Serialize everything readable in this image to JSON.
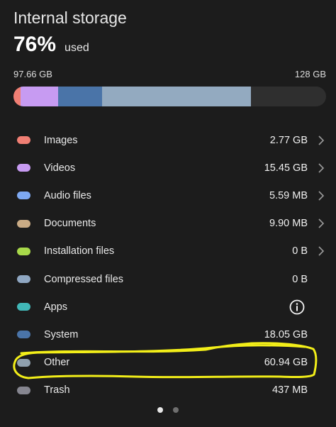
{
  "header": {
    "title": "Internal storage",
    "percent": "76%",
    "used_label": "used"
  },
  "bar": {
    "used_label": "97.66 GB",
    "total_label": "128 GB",
    "segments": [
      {
        "category": "Images",
        "gb": 2.77,
        "color": "#f07f74"
      },
      {
        "category": "Videos",
        "gb": 15.45,
        "color": "#c79bf2"
      },
      {
        "category": "System",
        "gb": 18.05,
        "color": "#4a74a8"
      },
      {
        "category": "Other",
        "gb": 60.94,
        "color": "#93aac0"
      }
    ],
    "total_gb": 128,
    "empty_color": "#2f2f2f"
  },
  "items": [
    {
      "label": "Images",
      "value": "2.77 GB",
      "color": "#f07f74",
      "action": "chevron"
    },
    {
      "label": "Videos",
      "value": "15.45 GB",
      "color": "#c79bf2",
      "action": "chevron"
    },
    {
      "label": "Audio files",
      "value": "5.59 MB",
      "color": "#7ea9f2",
      "action": "chevron"
    },
    {
      "label": "Documents",
      "value": "9.90 MB",
      "color": "#c9ab85",
      "action": "chevron"
    },
    {
      "label": "Installation files",
      "value": "0 B",
      "color": "#a8d94a",
      "action": "chevron"
    },
    {
      "label": "Compressed files",
      "value": "0 B",
      "color": "#8fa7c2",
      "action": "none"
    },
    {
      "label": "Apps",
      "value": "",
      "color": "#41b7b7",
      "action": "info"
    },
    {
      "label": "System",
      "value": "18.05 GB",
      "color": "#4a74a8",
      "action": "none"
    },
    {
      "label": "Other",
      "value": "60.94 GB",
      "color": "#8fa0ae",
      "action": "none"
    },
    {
      "label": "Trash",
      "value": "437 MB",
      "color": "#868690",
      "action": "none"
    }
  ],
  "icons": {
    "chevron": "chevron-right-icon",
    "info": "info-circle-icon"
  },
  "annotation": {
    "color": "#f2ee19",
    "target": "Other"
  },
  "pager": {
    "pages": 2,
    "active_page": 1,
    "active_color": "#e6e6e6",
    "inactive_color": "#6e6e6e"
  }
}
